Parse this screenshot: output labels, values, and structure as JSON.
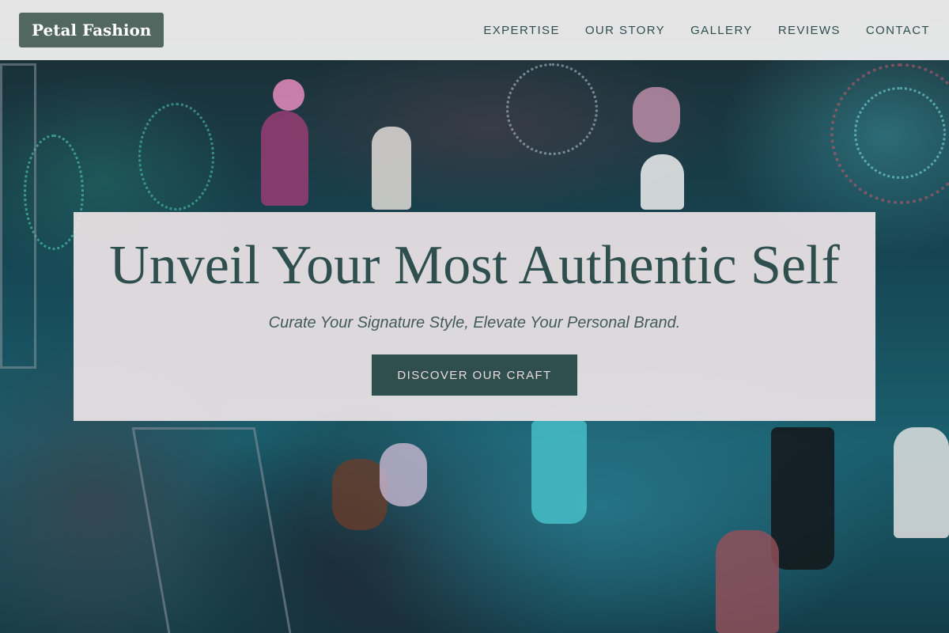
{
  "header": {
    "logo_text": "Petal Fashion",
    "nav": [
      {
        "label": "EXPERTISE"
      },
      {
        "label": "OUR STORY"
      },
      {
        "label": "GALLERY"
      },
      {
        "label": "REVIEWS"
      },
      {
        "label": "CONTACT"
      }
    ]
  },
  "hero": {
    "title": "Unveil Your Most Authentic Self",
    "subtitle": "Curate Your Signature Style, Elevate Your Personal Brand.",
    "cta_label": "DISCOVER OUR CRAFT",
    "background_image": "fashion-runway-photo"
  },
  "colors": {
    "header_bg": "#ececec",
    "logo_bg": "#526760",
    "primary_text": "#2f4f4f",
    "cta_bg": "#2f4f4f",
    "cta_text": "#eadadd",
    "panel_bg": "#f2e8ea"
  }
}
